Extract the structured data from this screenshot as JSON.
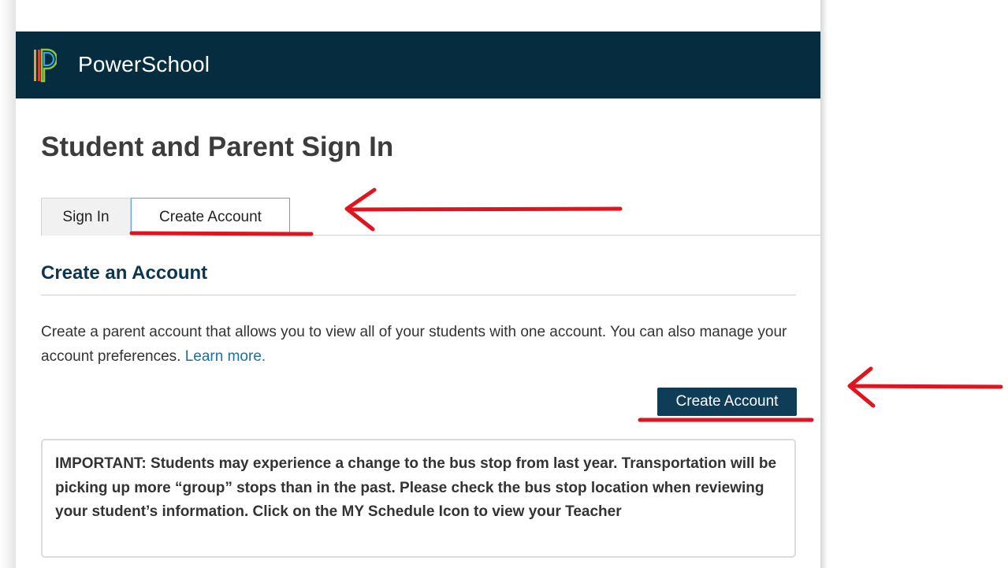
{
  "header": {
    "brand": "PowerSchool",
    "logo_icon": "powerschool-logo-icon",
    "background_color": "#052d3f"
  },
  "page": {
    "title": "Student and Parent Sign In"
  },
  "tabs": [
    {
      "label": "Sign In",
      "active": false
    },
    {
      "label": "Create Account",
      "active": true
    }
  ],
  "create_section": {
    "title": "Create an Account",
    "description": "Create a parent account that allows you to view all of your students with one account. You can also manage your account preferences. ",
    "learn_more": "Learn more.",
    "button_label": "Create Account"
  },
  "notice": {
    "text": "IMPORTANT: Students may experience a change to the bus stop from last year. Transportation will be picking up more “group” stops than in the past. Please check the bus stop location when reviewing your student’s information. Click on the MY Schedule Icon to view your Teacher"
  },
  "annotations": {
    "color": "#e0141e",
    "icons": [
      "arrow-left-icon",
      "underline-mark"
    ]
  }
}
